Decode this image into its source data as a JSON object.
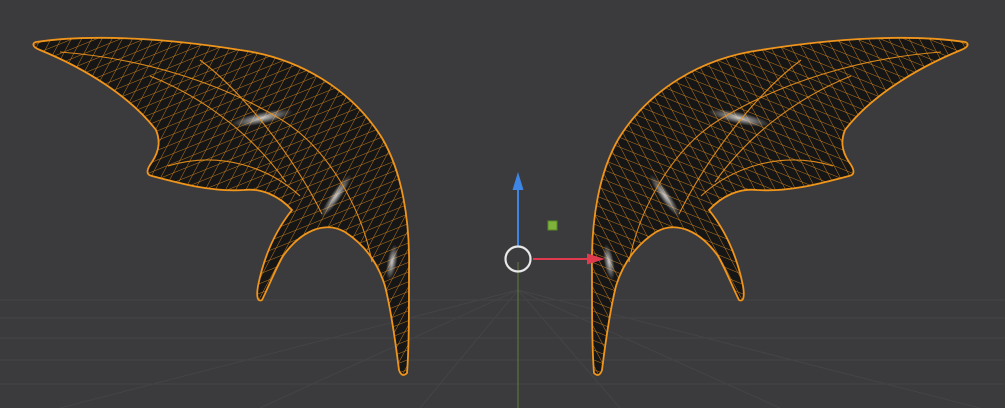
{
  "viewport": {
    "background": "#3b3b3d",
    "grid_color": "#454548",
    "wire_color": "#f0951c",
    "surface_color": "#141414",
    "highlight_color": "#cfcfcf"
  },
  "gizmo": {
    "z_axis_color": "#3d86e6",
    "x_axis_color": "#e03a4e",
    "y_axis_color": "#6f9c3a",
    "plane_handle_color": "#7fb23a",
    "pivot_ring_color": "#e8e8e8"
  },
  "objects": [
    {
      "name": "wing-left",
      "icon": "mesh-wireframe"
    },
    {
      "name": "wing-right",
      "icon": "mesh-wireframe"
    }
  ]
}
